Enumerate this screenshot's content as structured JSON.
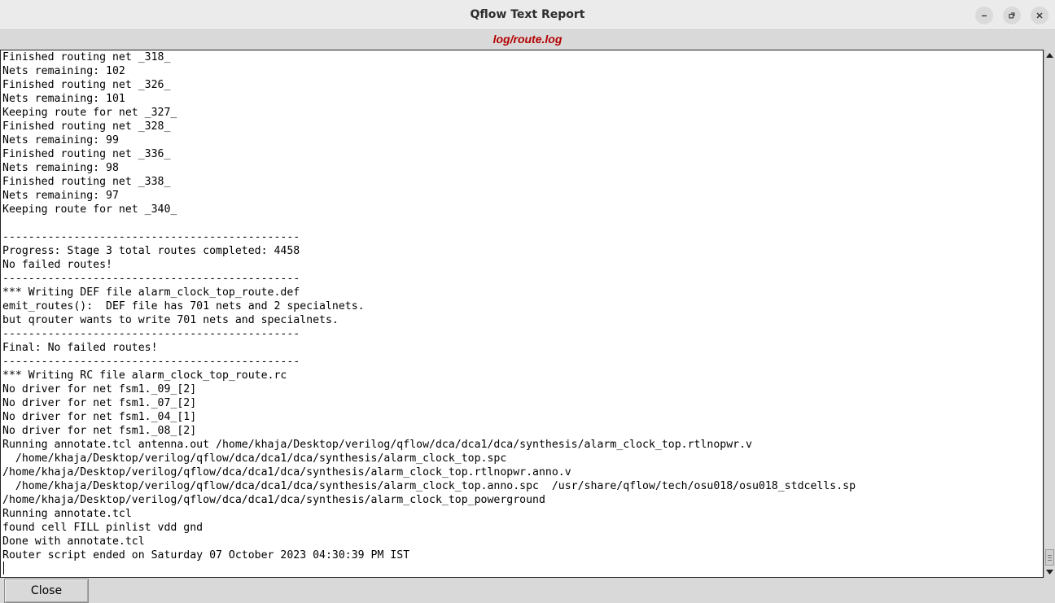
{
  "window": {
    "title": "Qflow Text Report",
    "subtitle": "log/route.log"
  },
  "window_controls": {
    "minimize_icon": "minimize-icon",
    "maximize_icon": "maximize-icon",
    "close_icon": "close-icon"
  },
  "log_lines": [
    "Finished routing net _318_",
    "Nets remaining: 102",
    "Finished routing net _326_",
    "Nets remaining: 101",
    "Keeping route for net _327_",
    "Finished routing net _328_",
    "Nets remaining: 99",
    "Finished routing net _336_",
    "Nets remaining: 98",
    "Finished routing net _338_",
    "Nets remaining: 97",
    "Keeping route for net _340_",
    "",
    "----------------------------------------------",
    "Progress: Stage 3 total routes completed: 4458",
    "No failed routes!",
    "----------------------------------------------",
    "*** Writing DEF file alarm_clock_top_route.def",
    "emit_routes():  DEF file has 701 nets and 2 specialnets.",
    "but qrouter wants to write 701 nets and specialnets.",
    "----------------------------------------------",
    "Final: No failed routes!",
    "----------------------------------------------",
    "*** Writing RC file alarm_clock_top_route.rc",
    "No driver for net fsm1._09_[2]",
    "No driver for net fsm1._07_[2]",
    "No driver for net fsm1._04_[1]",
    "No driver for net fsm1._08_[2]",
    "Running annotate.tcl antenna.out /home/khaja/Desktop/verilog/qflow/dca/dca1/dca/synthesis/alarm_clock_top.rtlnopwr.v",
    "  /home/khaja/Desktop/verilog/qflow/dca/dca1/dca/synthesis/alarm_clock_top.spc",
    "/home/khaja/Desktop/verilog/qflow/dca/dca1/dca/synthesis/alarm_clock_top.rtlnopwr.anno.v",
    "  /home/khaja/Desktop/verilog/qflow/dca/dca1/dca/synthesis/alarm_clock_top.anno.spc  /usr/share/qflow/tech/osu018/osu018_stdcells.sp",
    "/home/khaja/Desktop/verilog/qflow/dca/dca1/dca/synthesis/alarm_clock_top_powerground",
    "Running annotate.tcl",
    "found cell FILL pinlist vdd gnd",
    "Done with annotate.tcl",
    "Router script ended on Saturday 07 October 2023 04:30:39 PM IST"
  ],
  "buttons": {
    "close_label": "Close"
  },
  "colors": {
    "subtitle": "#b30000",
    "background": "#d9d9d9"
  }
}
